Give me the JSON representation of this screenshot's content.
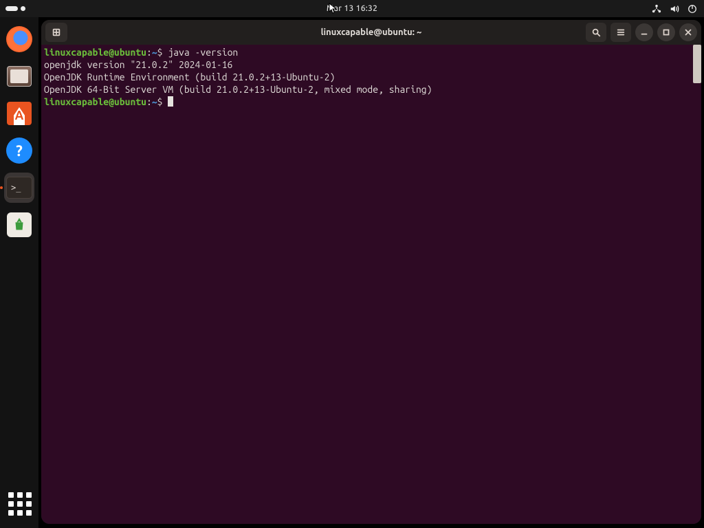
{
  "topbar": {
    "clock": "Mar 13  16:32"
  },
  "dock": {
    "items": [
      {
        "name": "firefox"
      },
      {
        "name": "files"
      },
      {
        "name": "software"
      },
      {
        "name": "help"
      },
      {
        "name": "terminal",
        "active": true
      },
      {
        "name": "trash"
      }
    ]
  },
  "window": {
    "title": "linuxcapable@ubuntu: ~"
  },
  "terminal": {
    "prompt_user": "linuxcapable@ubuntu",
    "prompt_sep": ":",
    "prompt_path": "~",
    "prompt_symbol": "$",
    "lines": [
      {
        "type": "cmd",
        "text": "java -version"
      },
      {
        "type": "out",
        "text": "openjdk version \"21.0.2\" 2024-01-16"
      },
      {
        "type": "out",
        "text": "OpenJDK Runtime Environment (build 21.0.2+13-Ubuntu-2)"
      },
      {
        "type": "out",
        "text": "OpenJDK 64-Bit Server VM (build 21.0.2+13-Ubuntu-2, mixed mode, sharing)"
      },
      {
        "type": "cmd",
        "text": ""
      }
    ]
  },
  "icons": {
    "terminal_prompt_glyph": ">_"
  }
}
